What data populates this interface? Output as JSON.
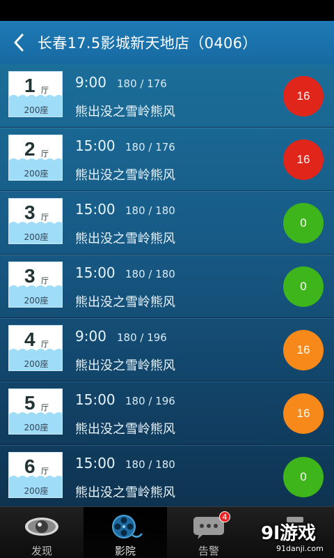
{
  "header": {
    "title": "长春17.5影城新天地店（0406）"
  },
  "showings": [
    {
      "hall": "1",
      "hall_unit": "厅",
      "seats": "200座",
      "time": "9:00",
      "count": "180 / 176",
      "movie": "熊出没之雪岭熊风",
      "badge": "16",
      "badge_color": "#e0261b"
    },
    {
      "hall": "2",
      "hall_unit": "厅",
      "seats": "200座",
      "time": "15:00",
      "count": "180 / 176",
      "movie": "熊出没之雪岭熊风",
      "badge": "16",
      "badge_color": "#e0261b"
    },
    {
      "hall": "3",
      "hall_unit": "厅",
      "seats": "200座",
      "time": "15:00",
      "count": "180 / 180",
      "movie": "熊出没之雪岭熊风",
      "badge": "0",
      "badge_color": "#3db51b"
    },
    {
      "hall": "3",
      "hall_unit": "厅",
      "seats": "200座",
      "time": "15:00",
      "count": "180 / 180",
      "movie": "熊出没之雪岭熊风",
      "badge": "0",
      "badge_color": "#3db51b"
    },
    {
      "hall": "4",
      "hall_unit": "厅",
      "seats": "200座",
      "time": "9:00",
      "count": "180 / 196",
      "movie": "熊出没之雪岭熊风",
      "badge": "16",
      "badge_color": "#f7891a"
    },
    {
      "hall": "5",
      "hall_unit": "厅",
      "seats": "200座",
      "time": "15:00",
      "count": "180 / 196",
      "movie": "熊出没之雪岭熊风",
      "badge": "16",
      "badge_color": "#f7891a"
    },
    {
      "hall": "6",
      "hall_unit": "厅",
      "seats": "200座",
      "time": "15:00",
      "count": "180 / 180",
      "movie": "熊出没之雪岭熊风",
      "badge": "0",
      "badge_color": "#3db51b"
    }
  ],
  "tabs": [
    {
      "label": "发现",
      "icon": "eye-icon"
    },
    {
      "label": "影院",
      "icon": "film-reel-icon",
      "active": true
    },
    {
      "label": "告警",
      "icon": "chat-bubble-icon",
      "notification": "4"
    },
    {
      "label": "",
      "icon": "more-icon"
    }
  ],
  "watermark": {
    "logo": "9l游戏",
    "url": "91danji.com"
  }
}
